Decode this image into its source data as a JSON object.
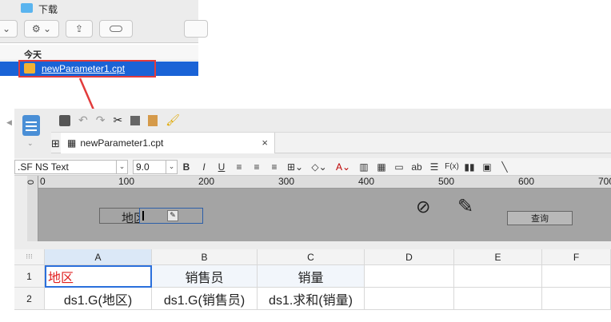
{
  "finder": {
    "title": "下载",
    "section_label": "今天",
    "file_name": "newParameter1.cpt"
  },
  "designer": {
    "tab_title": "newParameter1.cpt",
    "font_name": ".SF NS Text",
    "font_size": "9.0",
    "toolbar_glyphs": {
      "bold": "B",
      "italic": "I",
      "underline": "U",
      "text": "ab",
      "formula": "F(x)"
    },
    "ruler_marks": [
      "0",
      "100",
      "200",
      "300",
      "400",
      "500",
      "600",
      "700"
    ],
    "vruler_mark": "0",
    "param_label": "地区:",
    "query_button": "查询",
    "sheet": {
      "corner": "⁝⁝⁝",
      "columns": [
        "A",
        "B",
        "C",
        "D",
        "E",
        "F"
      ],
      "rows": [
        "1",
        "2"
      ],
      "cells": [
        [
          "地区",
          "销售员",
          "销量",
          "",
          "",
          ""
        ],
        [
          "ds1.G(地区)",
          "ds1.G(销售员)",
          "ds1.求和(销量)",
          "",
          "",
          ""
        ]
      ]
    }
  },
  "colors": {
    "accent": "#1a63d6",
    "highlight": "#e23b3b",
    "canvas": "#a4a4a4"
  }
}
